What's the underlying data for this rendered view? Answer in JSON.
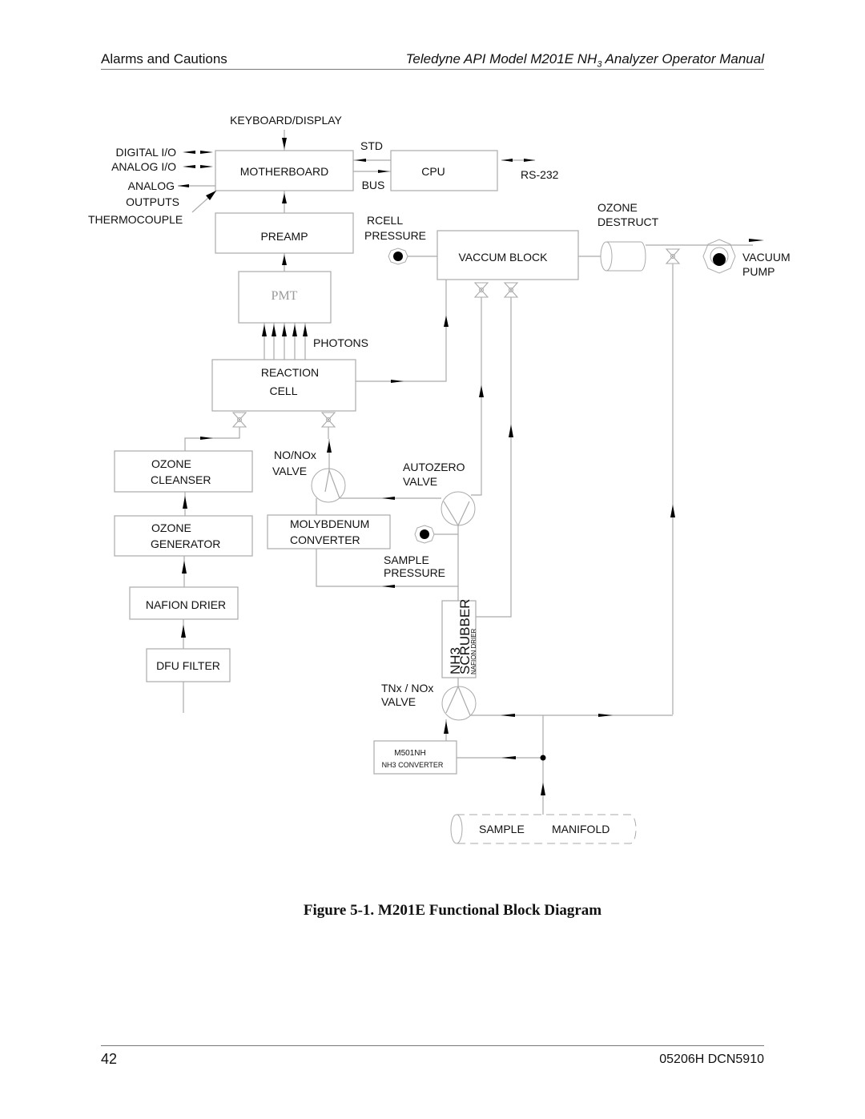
{
  "header": {
    "section": "Alarms and Cautions",
    "manual_title_prefix": "Teledyne API Model M201E NH",
    "manual_title_sub": "3",
    "manual_title_suffix": " Analyzer Operator Manual"
  },
  "figure": {
    "caption": "Figure 5-1. M201E Functional Block Diagram",
    "blocks": {
      "motherboard": "MOTHERBOARD",
      "cpu": "CPU",
      "preamp": "PREAMP",
      "pmt": "PMT",
      "reaction_cell_1": "REACTION",
      "reaction_cell_2": "CELL",
      "vaccum_block": "VACCUM BLOCK",
      "ozone_cleanser_1": "OZONE",
      "ozone_cleanser_2": "CLEANSER",
      "ozone_generator_1": "OZONE",
      "ozone_generator_2": "GENERATOR",
      "nafion_drier": "NAFION DRIER",
      "dfu_filter": "DFU FILTER",
      "molybdenum_1": "MOLYBDENUM",
      "molybdenum_2": "CONVERTER",
      "nh3_scrubber_1": "NH3",
      "nh3_scrubber_2": "SCRUBBER",
      "nh3_scrubber_3": "NAFION DRIER",
      "m501nh_1": "M501NH",
      "m501nh_2": "NH3 CONVERTER",
      "sample_manifold_1": "SAMPLE",
      "sample_manifold_2": "MANIFOLD"
    },
    "labels": {
      "keyboard_display": "KEYBOARD/DISPLAY",
      "digital_io": "DIGITAL  I/O",
      "analog_io": "ANALOG  I/O",
      "analog_outputs_1": "ANALOG",
      "analog_outputs_2": "OUTPUTS",
      "thermocouple": "THERMOCOUPLE",
      "std": "STD",
      "bus": "BUS",
      "rs232": "RS-232",
      "rcell_pressure_1": "RCELL",
      "rcell_pressure_2": "PRESSURE",
      "ozone_destruct_1": "OZONE",
      "ozone_destruct_2": "DESTRUCT",
      "vacuum_pump_1": "VACUUM",
      "vacuum_pump_2": "PUMP",
      "photons": "PHOTONS",
      "no_nox_valve_1": "NO/NOx",
      "no_nox_valve_2": "VALVE",
      "autozero_valve_1": "AUTOZERO",
      "autozero_valve_2": "VALVE",
      "sample_pressure_1": "SAMPLE",
      "sample_pressure_2": "PRESSURE",
      "tnx_nox_valve_1": "TNx / NOx",
      "tnx_nox_valve_2": "VALVE"
    }
  },
  "footer": {
    "page_number": "42",
    "doc_number": "05206H DCN5910"
  }
}
